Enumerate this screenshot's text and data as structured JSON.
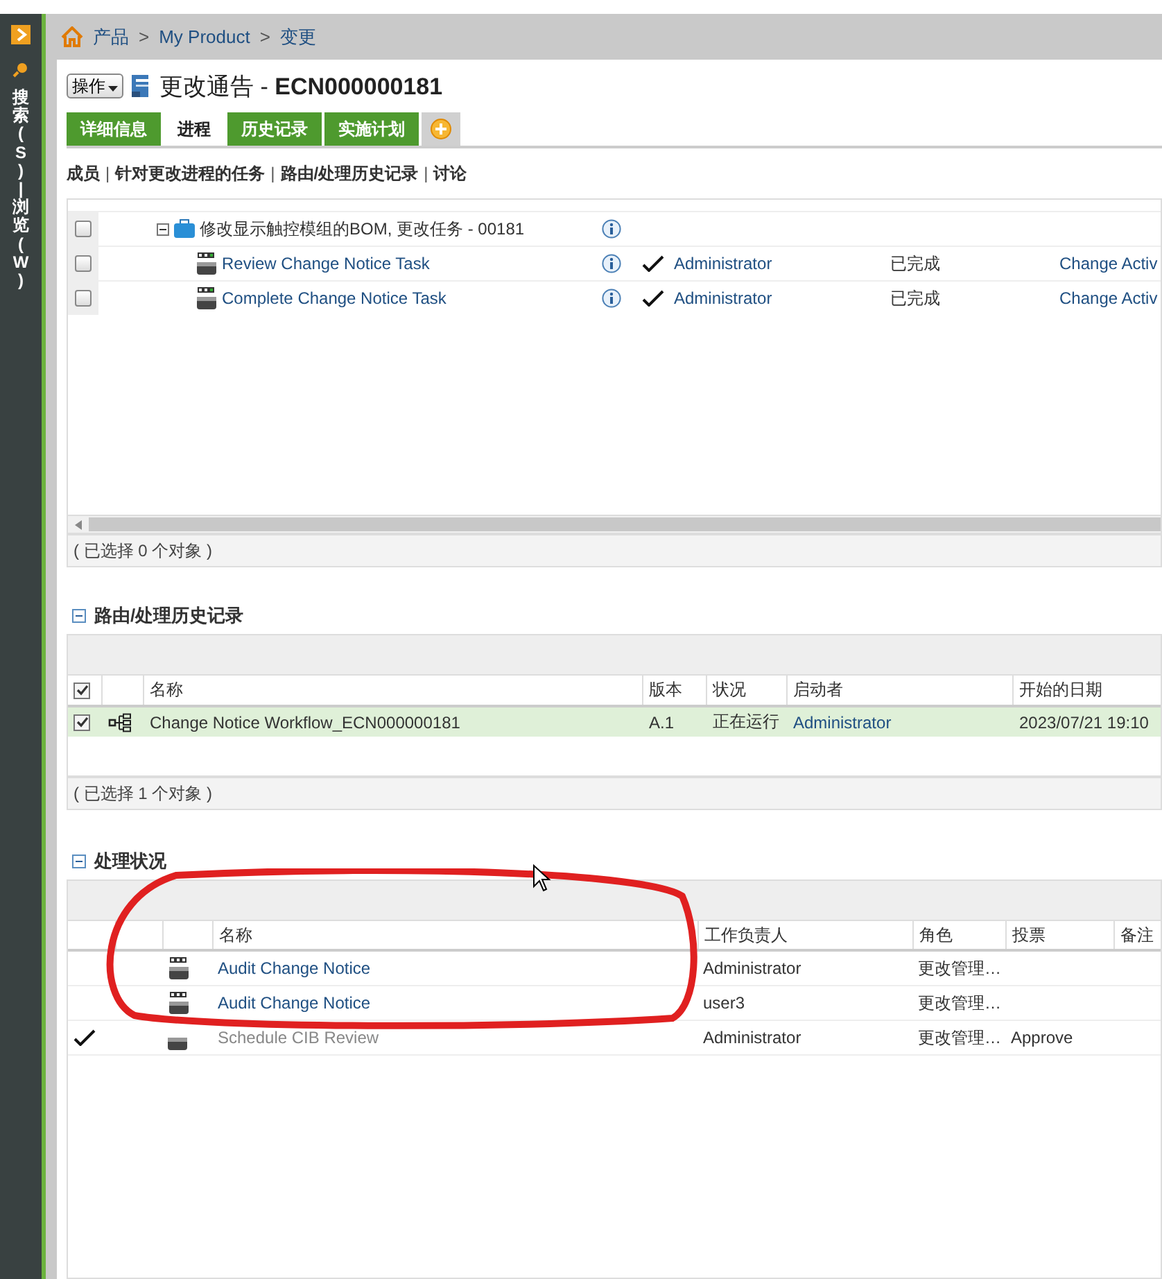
{
  "sidebar": {
    "label": "搜索(S) | 浏览(W)"
  },
  "breadcrumb": [
    "产品",
    "My Product",
    "变更"
  ],
  "breadcrumb_separator": ">",
  "header": {
    "actions_button": "操作",
    "title": "更改通告 - ",
    "title_id": "ECN000000181"
  },
  "tabs": [
    {
      "label": "详细信息",
      "selected": false
    },
    {
      "label": "进程",
      "selected": true
    },
    {
      "label": "历史记录",
      "selected": false
    },
    {
      "label": "实施计划",
      "selected": false
    }
  ],
  "section_links": [
    "成员",
    "针对更改进程的任务",
    "路由/处理历史记录",
    "讨论"
  ],
  "link_separator": "|",
  "tasks_table": {
    "rows": [
      {
        "kind": "group",
        "checked": false,
        "expanded": true,
        "name": "修改显示触控模组的BOM, 更改任务 - 00181",
        "done": false,
        "assignee": "",
        "status": "",
        "activity": ""
      },
      {
        "kind": "task",
        "checked": false,
        "name": "Review Change Notice Task",
        "done": true,
        "assignee": "Administrator",
        "status": "已完成",
        "activity": "Change Activ"
      },
      {
        "kind": "task",
        "checked": false,
        "name": "Complete Change Notice Task",
        "done": true,
        "assignee": "Administrator",
        "status": "已完成",
        "activity": "Change Activ"
      }
    ],
    "footer": "( 已选择 0 个对象 )"
  },
  "routing": {
    "title": "路由/处理历史记录",
    "expanded": true,
    "columns": [
      "名称",
      "版本",
      "状况",
      "启动者",
      "开始的日期"
    ],
    "rows": [
      {
        "checked": true,
        "name": "Change Notice Workflow_ECN000000181",
        "version": "A.1",
        "status": "正在运行",
        "initiator": "Administrator",
        "start": "2023/07/21 19:10"
      }
    ],
    "header_checked": true,
    "footer": "( 已选择 1 个对象 )"
  },
  "process": {
    "title": "处理状况",
    "expanded": true,
    "columns": [
      "名称",
      "工作负责人",
      "角色",
      "投票",
      "备注"
    ],
    "rows": [
      {
        "completed": false,
        "name": "Audit Change Notice",
        "assignee": "Administrator",
        "role": "更改管理…",
        "vote": ""
      },
      {
        "completed": false,
        "name": "Audit Change Notice",
        "assignee": "user3",
        "role": "更改管理…",
        "vote": ""
      },
      {
        "completed": true,
        "name": "Schedule CIB Review",
        "assignee": "Administrator",
        "role": "更改管理…",
        "vote": "Approve"
      }
    ]
  }
}
